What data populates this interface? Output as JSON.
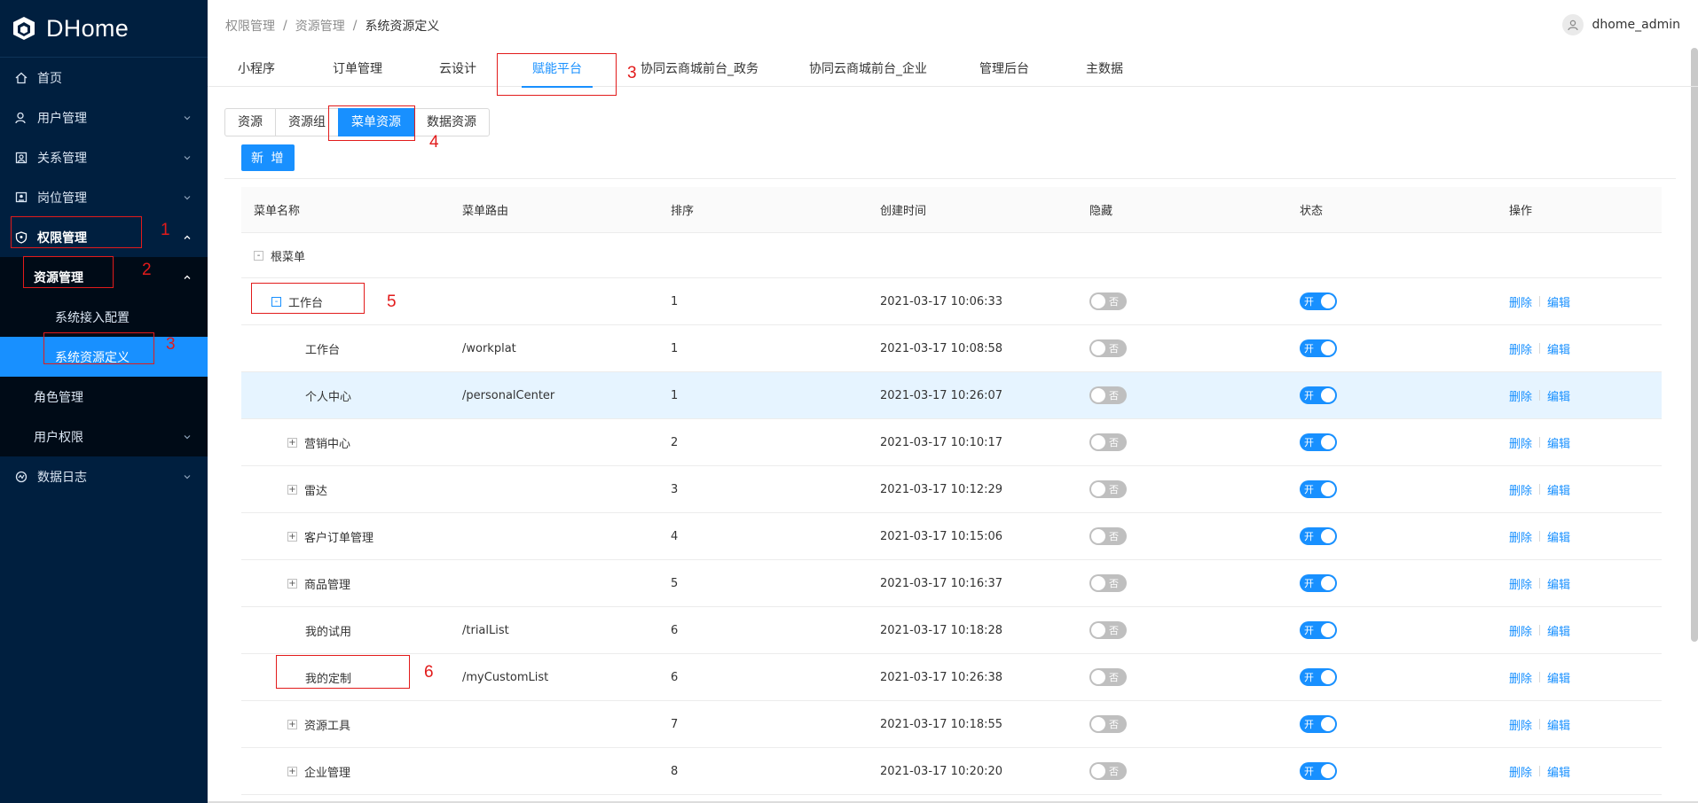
{
  "app": {
    "name": "DHome"
  },
  "sidebar": {
    "items": [
      {
        "label": "首页",
        "icon": "home-icon"
      },
      {
        "label": "用户管理",
        "icon": "user-icon"
      },
      {
        "label": "关系管理",
        "icon": "relation-icon"
      },
      {
        "label": "岗位管理",
        "icon": "position-icon"
      },
      {
        "label": "权限管理",
        "icon": "shield-icon"
      },
      {
        "label": "资源管理"
      },
      {
        "label": "系统接入配置"
      },
      {
        "label": "系统资源定义"
      },
      {
        "label": "角色管理"
      },
      {
        "label": "用户权限"
      },
      {
        "label": "数据日志",
        "icon": "log-icon"
      }
    ]
  },
  "header": {
    "breadcrumb": [
      "权限管理",
      "资源管理",
      "系统资源定义"
    ],
    "separator": "/",
    "username": "dhome_admin"
  },
  "top_tabs": [
    "小程序",
    "订单管理",
    "云设计",
    "赋能平台",
    "协同云商城前台_政务",
    "协同云商城前台_企业",
    "管理后台",
    "主数据"
  ],
  "sub_tabs": [
    "资源",
    "资源组",
    "菜单资源",
    "数据资源"
  ],
  "add_button": "新 增",
  "table": {
    "headers": [
      "菜单名称",
      "菜单路由",
      "排序",
      "创建时间",
      "隐藏",
      "状态",
      "操作"
    ],
    "root_label": "根菜单",
    "rows": [
      {
        "name": "工作台",
        "route": "",
        "order": "1",
        "time": "2021-03-17 10:06:33",
        "hidden": "否",
        "status": "开"
      },
      {
        "name": "工作台",
        "route": "/workplat",
        "order": "1",
        "time": "2021-03-17 10:08:58",
        "hidden": "否",
        "status": "开"
      },
      {
        "name": "个人中心",
        "route": "/personalCenter",
        "order": "1",
        "time": "2021-03-17 10:26:07",
        "hidden": "否",
        "status": "开"
      },
      {
        "name": "营销中心",
        "route": "",
        "order": "2",
        "time": "2021-03-17 10:10:17",
        "hidden": "否",
        "status": "开"
      },
      {
        "name": "雷达",
        "route": "",
        "order": "3",
        "time": "2021-03-17 10:12:29",
        "hidden": "否",
        "status": "开"
      },
      {
        "name": "客户订单管理",
        "route": "",
        "order": "4",
        "time": "2021-03-17 10:15:06",
        "hidden": "否",
        "status": "开"
      },
      {
        "name": "商品管理",
        "route": "",
        "order": "5",
        "time": "2021-03-17 10:16:37",
        "hidden": "否",
        "status": "开"
      },
      {
        "name": "我的试用",
        "route": "/trialList",
        "order": "6",
        "time": "2021-03-17 10:18:28",
        "hidden": "否",
        "status": "开"
      },
      {
        "name": "我的定制",
        "route": "/myCustomList",
        "order": "6",
        "time": "2021-03-17 10:26:38",
        "hidden": "否",
        "status": "开"
      },
      {
        "name": "资源工具",
        "route": "",
        "order": "7",
        "time": "2021-03-17 10:18:55",
        "hidden": "否",
        "status": "开"
      },
      {
        "name": "企业管理",
        "route": "",
        "order": "8",
        "time": "2021-03-17 10:20:20",
        "hidden": "否",
        "status": "开"
      }
    ],
    "ops": {
      "delete": "删除",
      "edit": "编辑"
    }
  },
  "annotations": [
    "1",
    "2",
    "3",
    "3",
    "4",
    "5",
    "6"
  ],
  "colors": {
    "sidebar_bg": "#001f3f",
    "accent": "#1890ff",
    "annotation": "#e21b1b",
    "highlight_row": "#e6f4ff"
  }
}
